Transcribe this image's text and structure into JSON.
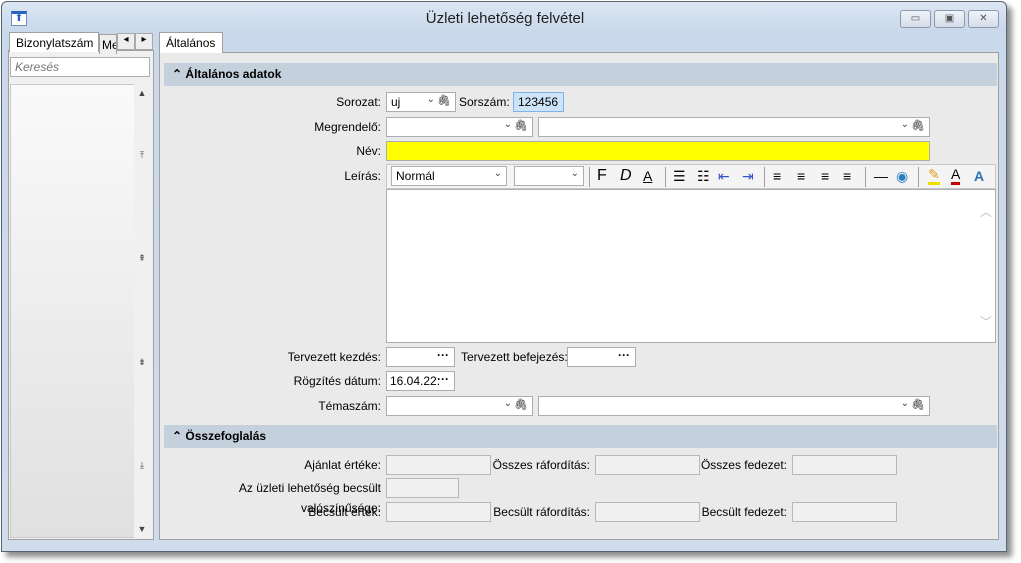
{
  "window": {
    "title": "Üzleti lehetőség felvétel",
    "minimize": "▭",
    "maximize": "▣",
    "close": "✕"
  },
  "left": {
    "tabs": [
      "Bizonylatszám",
      "Megrendelő"
    ],
    "tab_prev": "◂",
    "tab_next": "▸",
    "search_placeholder": "Keresés",
    "scroll": [
      "▲",
      "⤒",
      "⇞",
      "⇟",
      "⤓",
      "▼"
    ]
  },
  "main": {
    "tab": "Általános",
    "section1": {
      "title": "Általános adatok",
      "toggle": "⌃"
    },
    "sorozat": {
      "label": "Sorozat:",
      "value": "uj"
    },
    "sorszam": {
      "label": "Sorszám:",
      "value": "123456"
    },
    "megrendelo": {
      "label": "Megrendelő:"
    },
    "nev": {
      "label": "Név:",
      "value": ""
    },
    "leiras": {
      "label": "Leírás:",
      "style": "Normál",
      "toolbar": [
        "F",
        "D",
        "A",
        "☰",
        "☷",
        "⇤",
        "⇥",
        "≡",
        "≡",
        "≡",
        "≡",
        "—",
        "◉",
        "✎",
        "A",
        "A"
      ]
    },
    "tervezett_kezdes": {
      "label": "Tervezett kezdés:",
      "value": ""
    },
    "tervezett_befejezes": {
      "label": "Tervezett befejezés:",
      "value": ""
    },
    "rogzites": {
      "label": "Rögzítés dátum:",
      "value": "16.04.22."
    },
    "temaszam": {
      "label": "Témaszám:"
    },
    "section2": {
      "title": "Összefoglalás",
      "toggle": "⌃"
    },
    "ajanlat": {
      "label": "Ajánlat értéke:"
    },
    "osszes_raforditas": {
      "label": "Összes ráfordítás:"
    },
    "osszes_fedezet": {
      "label": "Összes fedezet:"
    },
    "valoszinuseg": {
      "label": "Az üzleti lehetőség becsült valószínűsége:"
    },
    "becsult_ertek": {
      "label": "Becsült érték:"
    },
    "becsult_raforditas": {
      "label": "Becsült ráfordítás:"
    },
    "becsult_fedezet": {
      "label": "Becsült fedezet:"
    },
    "dots": "···",
    "dropdown": "⌄",
    "clip": "🖇"
  }
}
